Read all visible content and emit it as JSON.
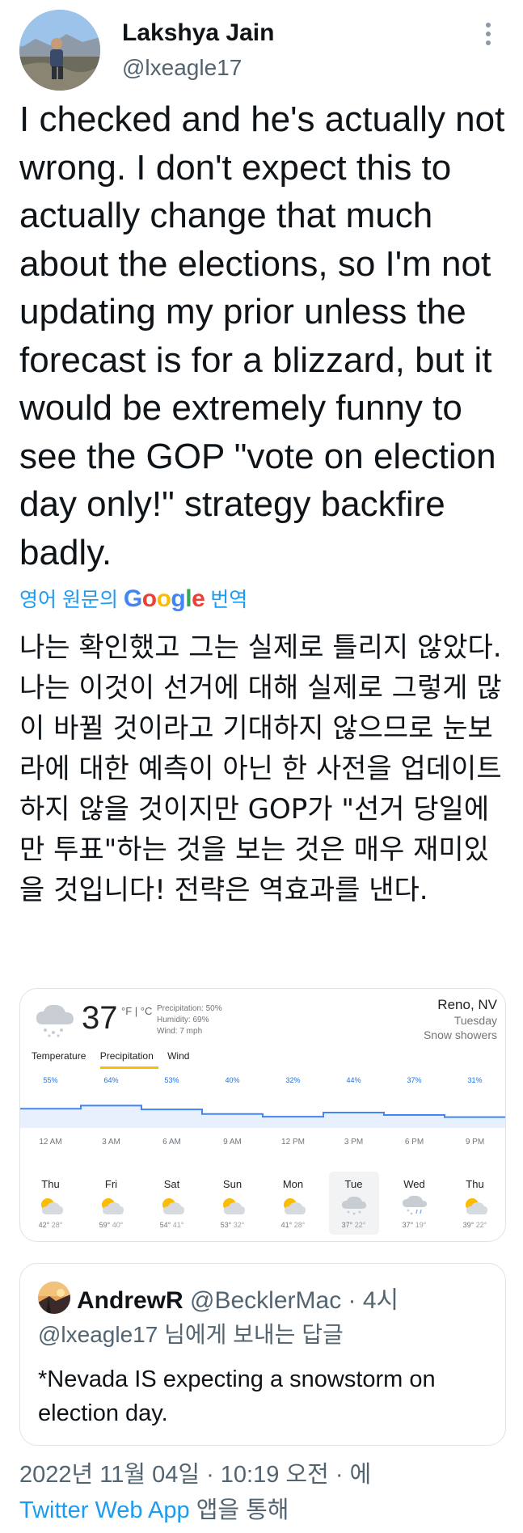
{
  "tweet": {
    "author_name": "Lakshya Jain",
    "author_handle": "@lxeagle17",
    "text": "I checked and he's actually not wrong. I don't expect this to actually change that much about the elections, so I'm not updating my prior unless the forecast is for a blizzard, but it would be extremely funny to see the GOP \"vote on election day only!\" strategy backfire badly.",
    "translate_prefix": "영어 원문의",
    "translate_brand": "Google",
    "translate_suffix": "번역",
    "translated_text": "나는 확인했고 그는 실제로 틀리지 않았다. 나는 이것이 선거에 대해 실제로 그렇게 많이 바뀔 것이라고 기대하지 않으므로 눈보라에 대한 예측이 아닌 한 사전을 업데이트하지 않을 것이지만 GOP가 \"선거 당일에만 투표\"하는 것을 보는 것은 매우 재미있을 것입니다! 전략은 역효과를 낸다."
  },
  "weather": {
    "temp": "37",
    "units": "°F | °C",
    "precipitation": "Precipitation: 50%",
    "humidity": "Humidity: 69%",
    "wind": "Wind: 7 mph",
    "location": "Reno, NV",
    "day": "Tuesday",
    "condition": "Snow showers",
    "tabs": [
      "Temperature",
      "Precipitation",
      "Wind"
    ],
    "active_tab": "Precipitation",
    "chart_data": {
      "type": "area",
      "x": [
        "12 AM",
        "3 AM",
        "6 AM",
        "9 AM",
        "12 PM",
        "3 PM",
        "6 PM",
        "9 PM"
      ],
      "values": [
        55,
        64,
        53,
        40,
        32,
        44,
        37,
        31
      ],
      "labels": [
        "55%",
        "64%",
        "53%",
        "40%",
        "32%",
        "44%",
        "37%",
        "31%"
      ]
    },
    "forecast": [
      {
        "day": "Thu",
        "high": "42°",
        "low": "28°",
        "icon": "partly-cloudy-icon"
      },
      {
        "day": "Fri",
        "high": "59°",
        "low": "40°",
        "icon": "partly-cloudy-icon"
      },
      {
        "day": "Sat",
        "high": "54°",
        "low": "41°",
        "icon": "partly-cloudy-icon"
      },
      {
        "day": "Sun",
        "high": "53°",
        "low": "32°",
        "icon": "partly-cloudy-icon"
      },
      {
        "day": "Mon",
        "high": "41°",
        "low": "28°",
        "icon": "partly-cloudy-icon"
      },
      {
        "day": "Tue",
        "high": "37°",
        "low": "22°",
        "icon": "snow-cloud-icon",
        "selected": true
      },
      {
        "day": "Wed",
        "high": "37°",
        "low": "19°",
        "icon": "snow-rain-icon"
      },
      {
        "day": "Thu",
        "high": "39°",
        "low": "22°",
        "icon": "partly-cloudy-icon"
      }
    ]
  },
  "quote": {
    "name": "AndrewR",
    "handle": "@BecklerMac",
    "time": "· 4시",
    "reply_to": "@lxeagle17 님에게 보내는 답글",
    "text": "*Nevada IS expecting a snowstorm on election day."
  },
  "meta": {
    "timestamp": "2022년 11월 04일 · 10:19 오전 · 에",
    "source": "Twitter Web App",
    "source_suffix": "앱을 통해"
  },
  "colors": {
    "accent": "#1d9bf0",
    "chart_line": "#4285f4",
    "chart_fill": "#e8f0fe",
    "sun": "#fbbc04"
  }
}
